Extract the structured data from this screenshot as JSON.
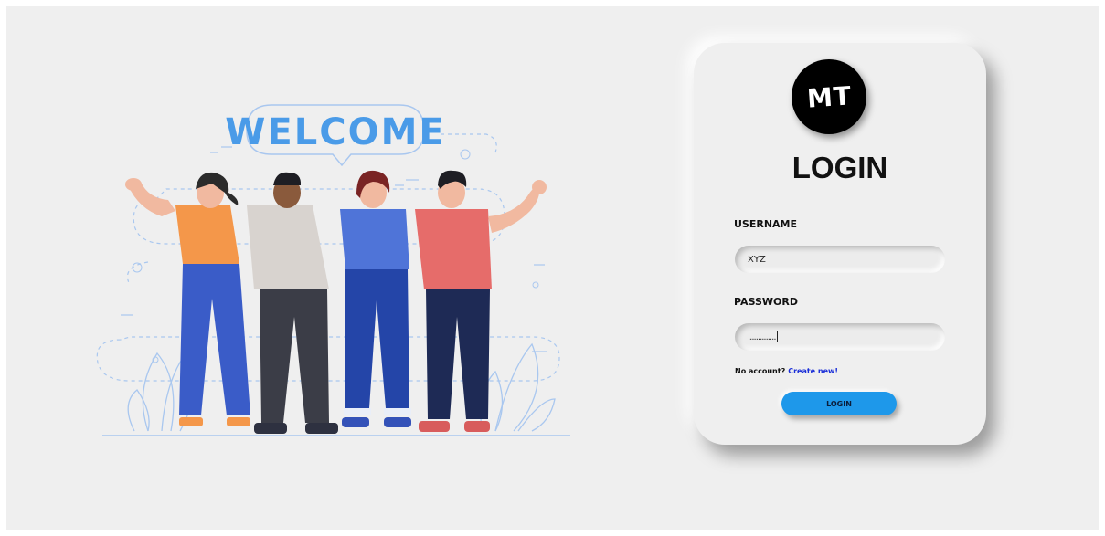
{
  "illustration": {
    "welcome_text": "WELCOME"
  },
  "login": {
    "logo_text": "MT",
    "title": "LOGIN",
    "username_label": "USERNAME",
    "username_value": "XYZ",
    "password_label": "PASSWORD",
    "password_masked": "..............",
    "no_account_text": "No account?",
    "create_link": "Create new!",
    "button_label": "LOGIN"
  },
  "colors": {
    "accent": "#1e98ea",
    "background": "#efefef",
    "link": "#1a2ed8",
    "welcome": "#4a9be8"
  }
}
